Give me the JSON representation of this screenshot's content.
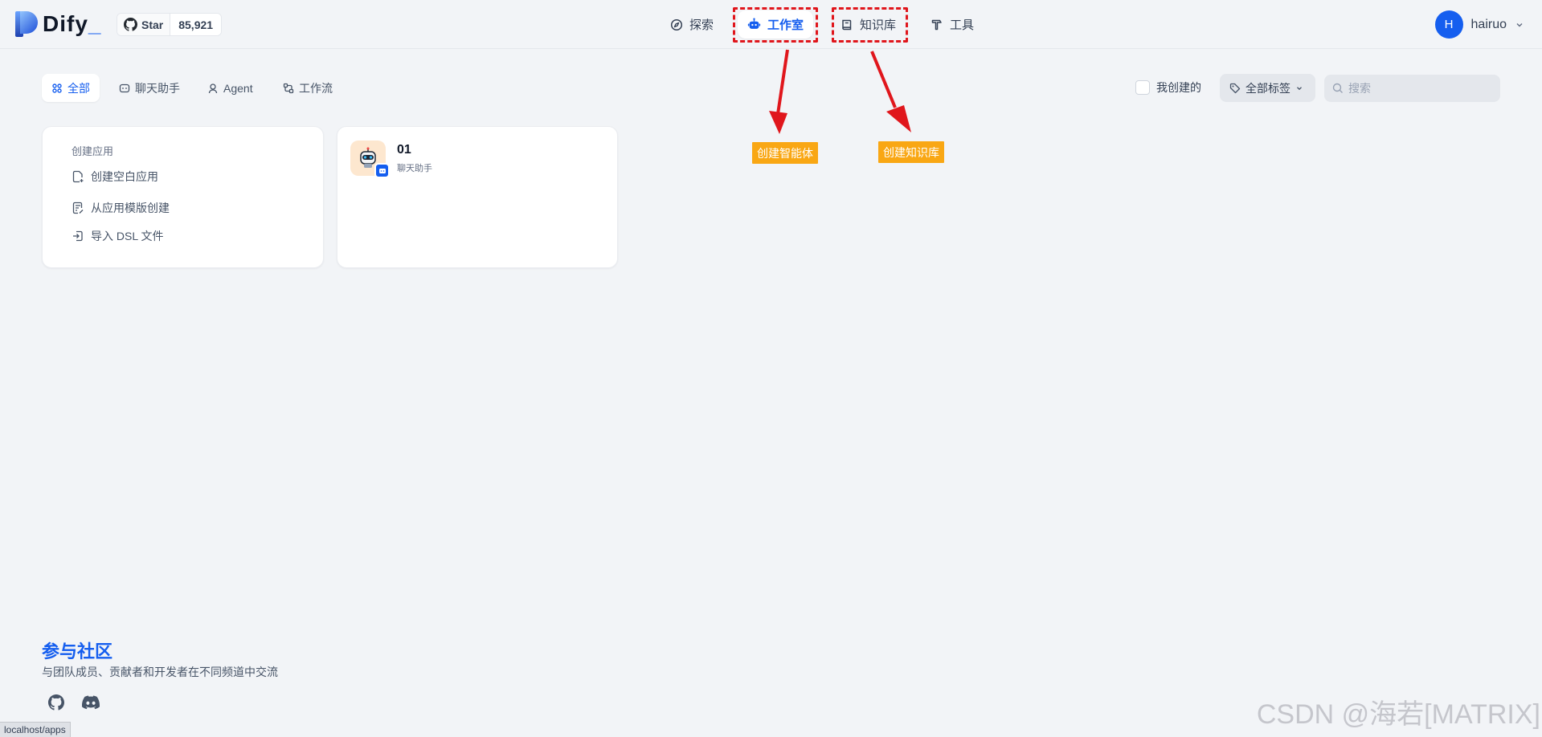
{
  "brand": {
    "name": "Dify",
    "accent": "#155eef"
  },
  "github": {
    "star_label": "Star",
    "star_count": "85,921"
  },
  "nav": [
    {
      "label": "探索",
      "icon": "compass-icon"
    },
    {
      "label": "工作室",
      "icon": "robot-icon",
      "active": true
    },
    {
      "label": "知识库",
      "icon": "book-icon"
    },
    {
      "label": "工具",
      "icon": "hammer-icon"
    }
  ],
  "user": {
    "initial": "H",
    "name": "hairuo"
  },
  "filters": {
    "tabs": [
      {
        "label": "全部",
        "icon": "grid-icon",
        "active": true
      },
      {
        "label": "聊天助手",
        "icon": "chat-icon"
      },
      {
        "label": "Agent",
        "icon": "agent-icon"
      },
      {
        "label": "工作流",
        "icon": "workflow-icon"
      }
    ],
    "mine_label": "我创建的",
    "tag_select": "全部标签",
    "search_placeholder": "搜索"
  },
  "create_card": {
    "title": "创建应用",
    "options": [
      {
        "label": "创建空白应用",
        "icon": "file-plus-icon"
      },
      {
        "label": "从应用模版创建",
        "icon": "file-template-icon"
      },
      {
        "label": "导入 DSL 文件",
        "icon": "import-icon"
      }
    ]
  },
  "apps": [
    {
      "name": "01",
      "type": "聊天助手"
    }
  ],
  "annotations": {
    "studio": "创建智能体",
    "knowledge": "创建知识库",
    "arrow_color": "#e0161c",
    "label_color": "#f9a714"
  },
  "community": {
    "title": "参与社区",
    "description": "与团队成员、贡献者和开发者在不同频道中交流"
  },
  "status_bar": {
    "url": "localhost/apps"
  },
  "watermark": "CSDN @海若[MATRIX]"
}
